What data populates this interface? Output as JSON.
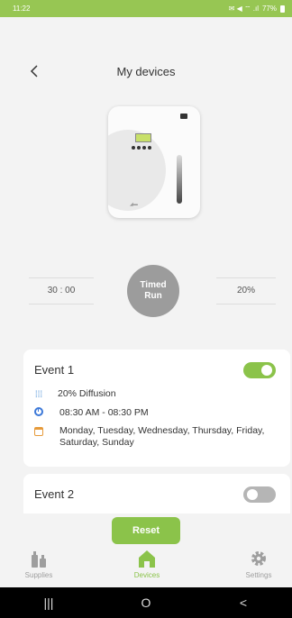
{
  "status_bar": {
    "time": "11:22",
    "indicators": "✉ ◀ ⌔ .ıl",
    "battery": "77%"
  },
  "header": {
    "back_icon": "chevron-left-icon",
    "title": "My devices"
  },
  "controls": {
    "timer_value": "30 : 00",
    "run_label": "Timed Run",
    "intensity_value": "20%"
  },
  "events": [
    {
      "title": "Event 1",
      "enabled": true,
      "diffusion": "20% Diffusion",
      "time_range": "08:30 AM - 08:30 PM",
      "days": "Monday, Tuesday, Wednesday, Thursday, Friday, Saturday, Sunday"
    },
    {
      "title": "Event 2",
      "enabled": false
    }
  ],
  "reset_label": "Reset",
  "bottom_nav": [
    {
      "label": "Supplies",
      "icon": "bottles-icon",
      "active": false
    },
    {
      "label": "Devices",
      "icon": "home-icon",
      "active": true
    },
    {
      "label": "Settings",
      "icon": "gear-icon",
      "active": false
    }
  ],
  "android_nav": {
    "recents": "|||",
    "home": "O",
    "back": "<"
  },
  "colors": {
    "brand_green": "#8bc34a",
    "status_green": "#97c653",
    "inactive_gray": "#9e9e9e"
  }
}
